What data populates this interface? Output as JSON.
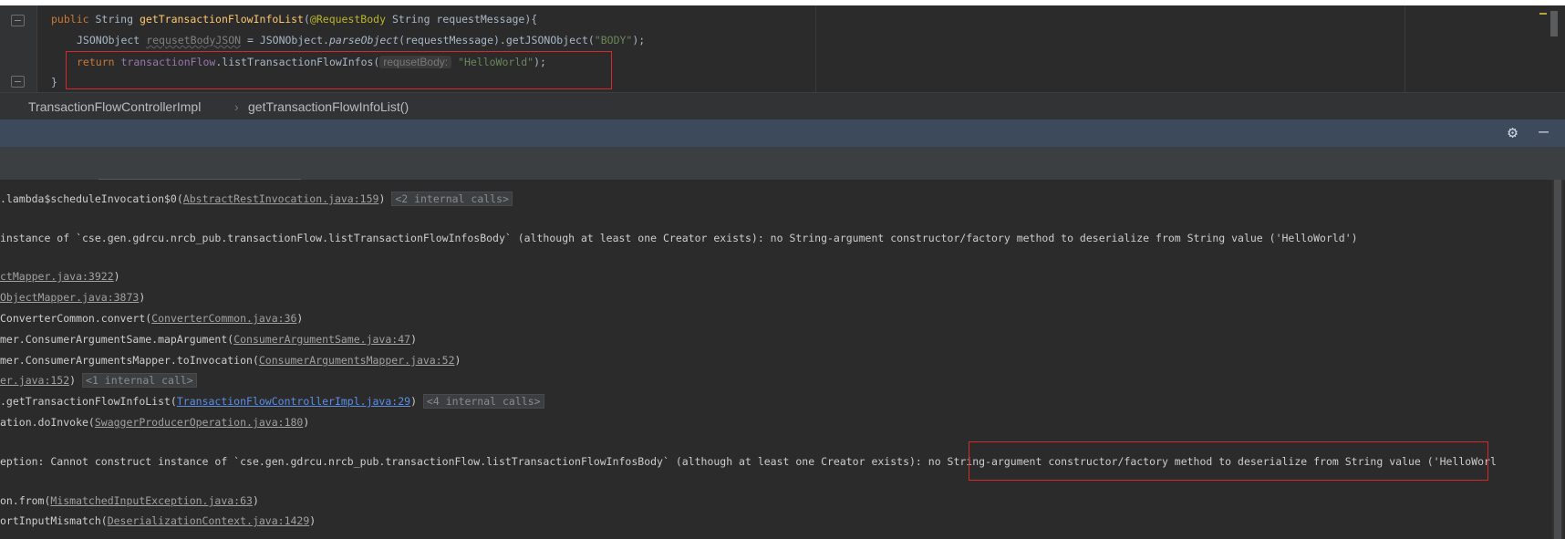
{
  "editor": {
    "line1": {
      "kw": "public",
      "type": "String",
      "method": "getTransactionFlowInfoList",
      "annotation": "@RequestBody",
      "param": "String requestMessage){"
    },
    "line2": {
      "type": "JSONObject",
      "var": "requsetBodyJSON",
      "eq": " = JSONObject.",
      "static_method": "parseObject",
      "rest": "(requestMessage).getJSONObject(",
      "str": "\"BODY\"",
      "end": ");"
    },
    "line3": {
      "kw": "return",
      "field": "transactionFlow",
      "call": ".listTransactionFlowInfos(",
      "hint": "requsetBody:",
      "str": "\"HelloWorld\"",
      "end": ");"
    },
    "line4": "}"
  },
  "breadcrumb": {
    "class": "TransactionFlowControllerImpl",
    "separator": "›",
    "method": "getTransactionFlowInfoList()"
  },
  "icons": {
    "gear": "gear-icon",
    "minimize": "minimize-icon"
  },
  "console": {
    "l1": {
      "a": ".lambda$scheduleInvocation$0(",
      "link": "AbstractRestInvocation.java:159",
      "b": ")",
      "ic": "<2 internal calls>"
    },
    "l2": "instance of `cse.gen.gdrcu.nrcb_pub.transactionFlow.listTransactionFlowInfosBody` (although at least one Creator exists): no String-argument constructor/factory method to deserialize from String value ('HelloWorld')",
    "l3": {
      "link": "ctMapper.java:3922",
      "b": ")"
    },
    "l4": {
      "link": "ObjectMapper.java:3873",
      "b": ")"
    },
    "l5": {
      "a": "ConverterCommon.convert(",
      "link": "ConverterCommon.java:36",
      "b": ")"
    },
    "l6": {
      "a": "mer.ConsumerArgumentSame.mapArgument(",
      "link": "ConsumerArgumentSame.java:47",
      "b": ")"
    },
    "l7": {
      "a": "mer.ConsumerArgumentsMapper.toInvocation(",
      "link": "ConsumerArgumentsMapper.java:52",
      "b": ")"
    },
    "l8": {
      "link": "er.java:152",
      "b": ") ",
      "ic": "<1 internal call>"
    },
    "l9": {
      "a": ".getTransactionFlowInfoList(",
      "link": "TransactionFlowControllerImpl.java:29",
      "b": ") ",
      "ic": "<4 internal calls>"
    },
    "l10": {
      "a": "ation.doInvoke(",
      "link": "SwaggerProducerOperation.java:180",
      "b": ")"
    },
    "l11": "eption: Cannot construct instance of `cse.gen.gdrcu.nrcb_pub.transactionFlow.listTransactionFlowInfosBody` (although at least one Creator exists): no String-argument constructor/factory method to deserialize from String value ('HelloWorl",
    "l12": {
      "a": "on.from(",
      "link": "MismatchedInputException.java:63",
      "b": ")"
    },
    "l13": {
      "a": "ortInputMismatch(",
      "link": "DeserializationContext.java:1429",
      "b": ")"
    }
  }
}
